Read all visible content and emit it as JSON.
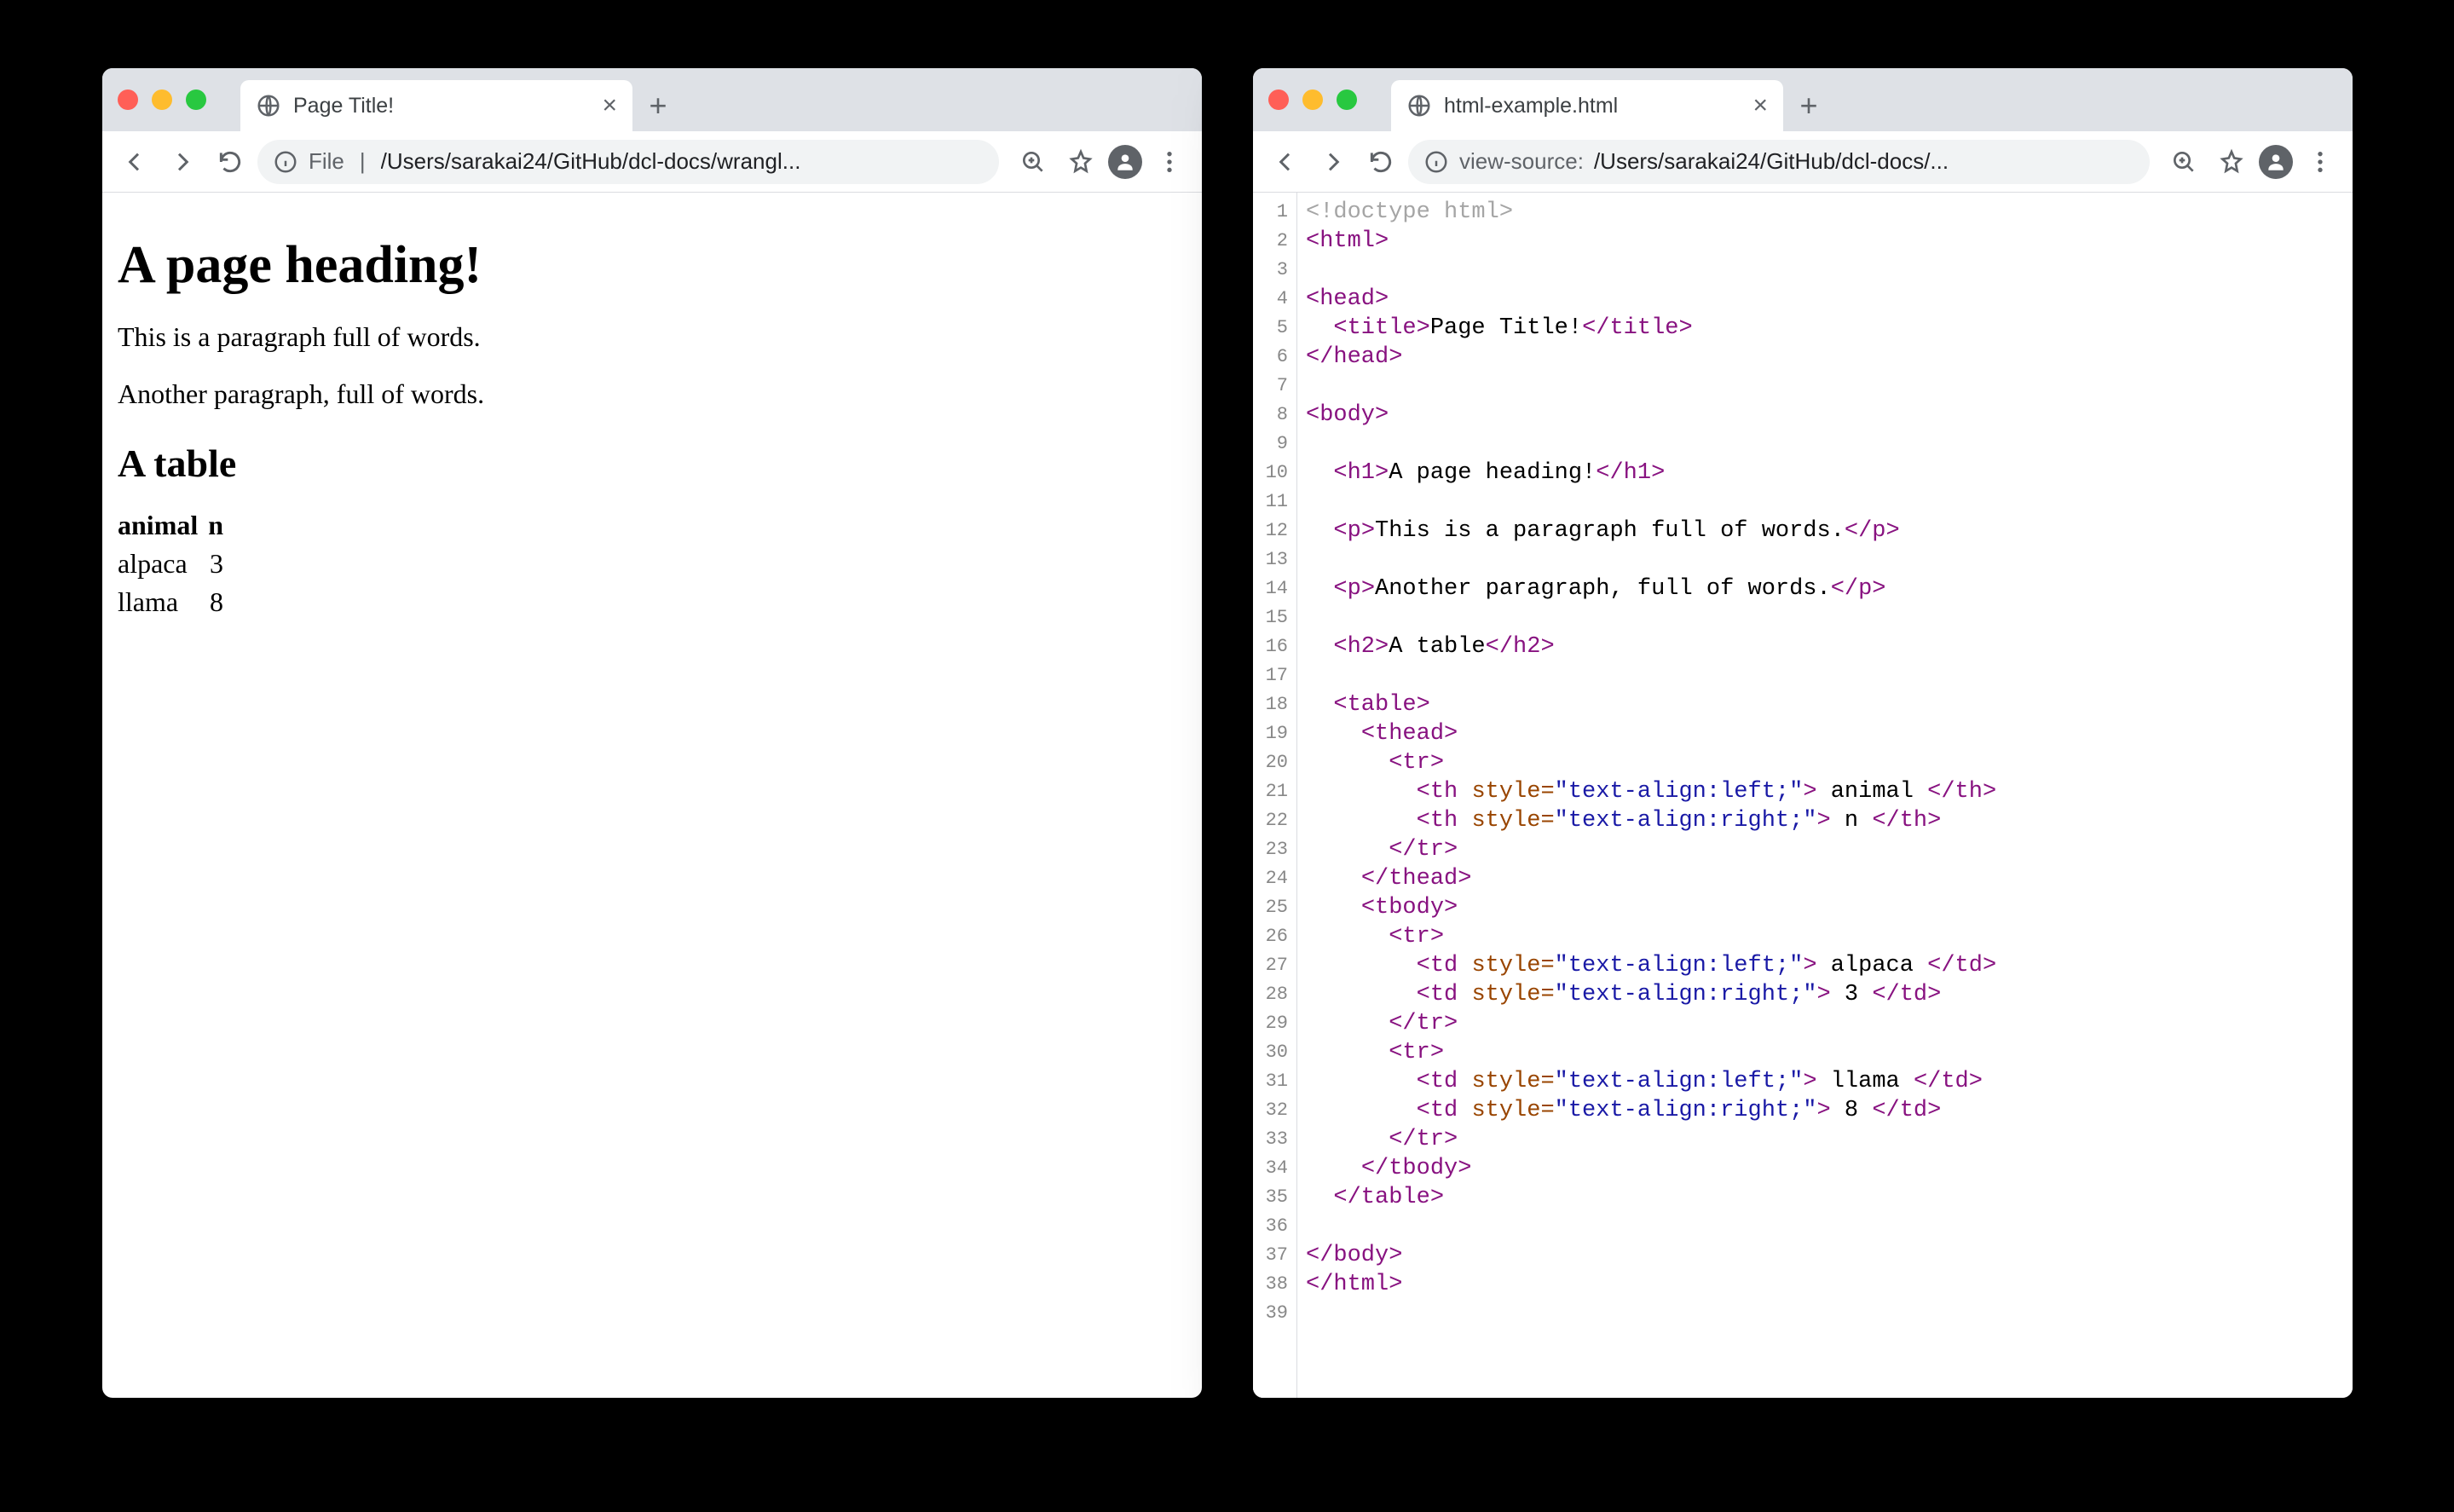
{
  "left": {
    "tab_title": "Page Title!",
    "url_prefix": "File",
    "url_path": "/Users/sarakai24/GitHub/dcl-docs/wrangl...",
    "page": {
      "h1": "A page heading!",
      "p1": "This is a paragraph full of words.",
      "p2": "Another paragraph, full of words.",
      "h2": "A table",
      "table": {
        "headers": [
          "animal",
          "n"
        ],
        "rows": [
          [
            "alpaca",
            "3"
          ],
          [
            "llama",
            "8"
          ]
        ]
      }
    }
  },
  "right": {
    "tab_title": "html-example.html",
    "url_prefix": "view-source:",
    "url_path": "/Users/sarakai24/GitHub/dcl-docs/...",
    "line_count": 39,
    "source_lines": [
      {
        "indent": 0,
        "doctype": "<!doctype html>"
      },
      {
        "indent": 0,
        "open": "html"
      },
      {
        "blank": true
      },
      {
        "indent": 0,
        "open": "head"
      },
      {
        "indent": 1,
        "open": "title",
        "text": "Page Title!",
        "close": "title"
      },
      {
        "indent": 0,
        "closeOnly": "head"
      },
      {
        "blank": true
      },
      {
        "indent": 0,
        "open": "body"
      },
      {
        "blank": true
      },
      {
        "indent": 1,
        "open": "h1",
        "text": "A page heading!",
        "close": "h1"
      },
      {
        "blank": true
      },
      {
        "indent": 1,
        "open": "p",
        "text": "This is a paragraph full of words.",
        "close": "p"
      },
      {
        "blank": true
      },
      {
        "indent": 1,
        "open": "p",
        "text": "Another paragraph, full of words.",
        "close": "p"
      },
      {
        "blank": true
      },
      {
        "indent": 1,
        "open": "h2",
        "text": "A table",
        "close": "h2"
      },
      {
        "blank": true
      },
      {
        "indent": 1,
        "open": "table"
      },
      {
        "indent": 2,
        "open": "thead"
      },
      {
        "indent": 3,
        "open": "tr"
      },
      {
        "indent": 4,
        "open": "th",
        "attr": "style",
        "val": "text-align:left;",
        "text": " animal ",
        "close": "th"
      },
      {
        "indent": 4,
        "open": "th",
        "attr": "style",
        "val": "text-align:right;",
        "text": " n ",
        "close": "th"
      },
      {
        "indent": 3,
        "closeOnly": "tr"
      },
      {
        "indent": 2,
        "closeOnly": "thead"
      },
      {
        "indent": 2,
        "open": "tbody"
      },
      {
        "indent": 3,
        "open": "tr"
      },
      {
        "indent": 4,
        "open": "td",
        "attr": "style",
        "val": "text-align:left;",
        "text": " alpaca ",
        "close": "td"
      },
      {
        "indent": 4,
        "open": "td",
        "attr": "style",
        "val": "text-align:right;",
        "text": " 3 ",
        "close": "td"
      },
      {
        "indent": 3,
        "closeOnly": "tr"
      },
      {
        "indent": 3,
        "open": "tr"
      },
      {
        "indent": 4,
        "open": "td",
        "attr": "style",
        "val": "text-align:left;",
        "text": " llama ",
        "close": "td"
      },
      {
        "indent": 4,
        "open": "td",
        "attr": "style",
        "val": "text-align:right;",
        "text": " 8 ",
        "close": "td"
      },
      {
        "indent": 3,
        "closeOnly": "tr"
      },
      {
        "indent": 2,
        "closeOnly": "tbody"
      },
      {
        "indent": 1,
        "closeOnly": "table"
      },
      {
        "blank": true
      },
      {
        "indent": 0,
        "closeOnly": "body"
      },
      {
        "indent": 0,
        "closeOnly": "html"
      },
      {
        "blank": true
      }
    ]
  }
}
